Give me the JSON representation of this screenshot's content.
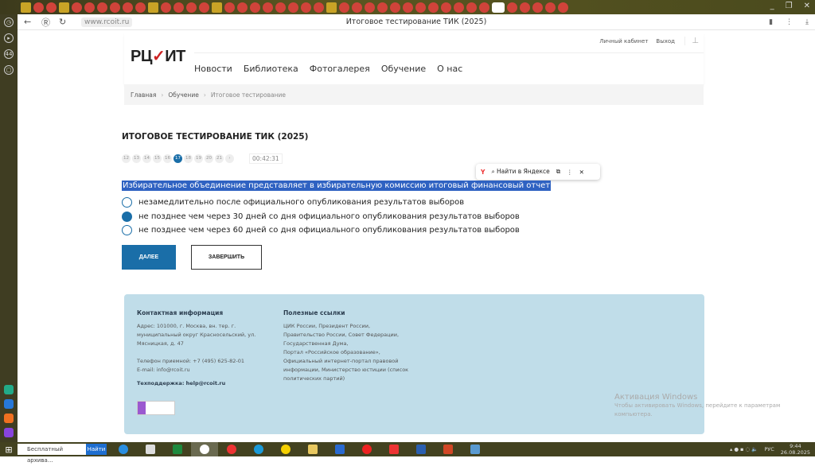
{
  "browser": {
    "url": "www.rcoit.ru",
    "title": "Итоговое тестирование ТИК (2025)",
    "tab_count_badge": "44"
  },
  "header": {
    "logo": "РЦОИТ",
    "top_links": [
      "Личный кабинет",
      "Выход"
    ],
    "menu": [
      "Новости",
      "Библиотека",
      "Фотогалерея",
      "Обучение",
      "О нас"
    ]
  },
  "breadcrumb": [
    "Главная",
    "Обучение",
    "Итоговое тестирование"
  ],
  "test": {
    "title": "ИТОГОВОЕ ТЕСТИРОВАНИЕ ТИК (2025)",
    "pages": [
      "12",
      "13",
      "14",
      "15",
      "16",
      "17",
      "18",
      "19",
      "20",
      "21",
      "›"
    ],
    "current_page": "17",
    "timer": "00:42:31",
    "question": "Избирательное объединение представляет в избирательную комиссию итоговый финансовый отчет",
    "options": [
      "незамедлительно после официального опубликования результатов выборов",
      "не позднее чем через 30 дней со дня официального опубликования результатов выборов",
      "не позднее чем через 60 дней со дня официального опубликования результатов выборов"
    ],
    "selected_option": 1,
    "next_label": "ДАЛЕЕ",
    "finish_label": "ЗАВЕРШИТЬ"
  },
  "yandex_popup": {
    "find_label": "Найти в Яндексе"
  },
  "footer": {
    "contact_title": "Контактная информация",
    "address": "Адрес:  101000, г. Москва, вн. тер. г. муниципальный округ Красносельский, ул. Мясницкая, д. 47",
    "phone": "Телефон приемной:  +7 (495) 625-82-01",
    "email": "E-mail:  info@rcoit.ru",
    "support": "Техподдержка:  help@rcoit.ru",
    "links_title": "Полезные ссылки",
    "links": [
      "ЦИК России, Президент России,",
      "Правительство России, Совет Федерации,",
      "Государственная Дума,",
      "Портал «Российское образование»,",
      "Официальный интернет-портал правовой",
      "информации, Министерство юстиции (список",
      "политических партий)"
    ]
  },
  "windows_activation": {
    "title": "Активация Windows",
    "text": "Чтобы активировать Windows, перейдите к параметрам компьютера."
  },
  "taskbar": {
    "search_text": "Бесплатный архива...",
    "search_button": "Найти",
    "lang": "РУС",
    "time": "9:44",
    "date": "26.08.2025"
  },
  "colors": {
    "accent": "#1a6ea8",
    "footer_bg": "#c0dde9",
    "selection": "#2f62c2"
  }
}
